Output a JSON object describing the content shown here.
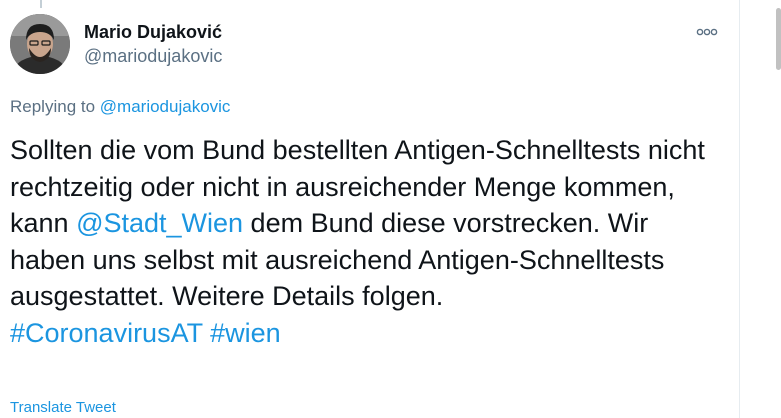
{
  "tweet": {
    "author_name": "Mario Dujaković",
    "author_handle": "@mariodujakovic",
    "replying_to_prefix": "Replying to ",
    "replying_to_handle": "@mariodujakovic",
    "text_part1": "Sollten die vom Bund bestellten Antigen-Schnelltests nicht rechtzeitig oder nicht in ausreichender Menge kommen, kann ",
    "mention": "@Stadt_Wien",
    "text_part2": " dem Bund diese vorstrecken. Wir haben uns selbst mit ausreichend Antigen-Schnelltests ausgestattet. Weitere Details folgen.",
    "hashtag1": "#CoronavirusAT",
    "hashtag2": "#wien",
    "translate_label": "Translate Tweet"
  },
  "icons": {
    "more": "more-options-icon"
  },
  "colors": {
    "link": "#1b95e0",
    "secondary_text": "#5b7083",
    "primary_text": "#0f1419"
  }
}
